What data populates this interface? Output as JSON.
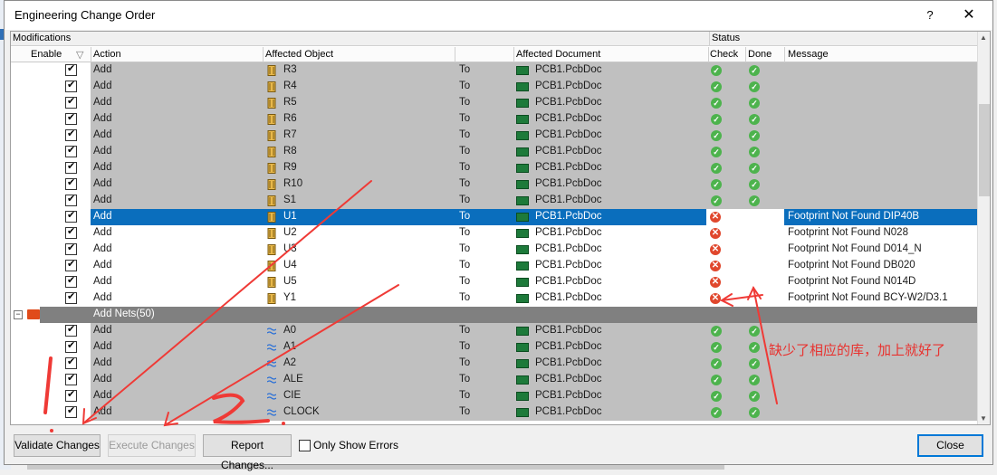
{
  "dialog": {
    "title": "Engineering Change Order",
    "help": "?",
    "close_glyph": "✕"
  },
  "grid": {
    "group_modifications": "Modifications",
    "group_status": "Status",
    "col_enable": "Enable",
    "col_action": "Action",
    "col_object": "Affected Object",
    "col_document": "Affected Document",
    "col_check": "Check",
    "col_done": "Done",
    "col_message": "Message",
    "rows": [
      {
        "kind": "ok",
        "action": "Add",
        "object": "R3",
        "to": "To",
        "doc": "PCB1.PcbDoc",
        "icon": "component-icon",
        "message": ""
      },
      {
        "kind": "ok",
        "action": "Add",
        "object": "R4",
        "to": "To",
        "doc": "PCB1.PcbDoc",
        "icon": "component-icon",
        "message": ""
      },
      {
        "kind": "ok",
        "action": "Add",
        "object": "R5",
        "to": "To",
        "doc": "PCB1.PcbDoc",
        "icon": "component-icon",
        "message": ""
      },
      {
        "kind": "ok",
        "action": "Add",
        "object": "R6",
        "to": "To",
        "doc": "PCB1.PcbDoc",
        "icon": "component-icon",
        "message": ""
      },
      {
        "kind": "ok",
        "action": "Add",
        "object": "R7",
        "to": "To",
        "doc": "PCB1.PcbDoc",
        "icon": "component-icon",
        "message": ""
      },
      {
        "kind": "ok",
        "action": "Add",
        "object": "R8",
        "to": "To",
        "doc": "PCB1.PcbDoc",
        "icon": "component-icon",
        "message": ""
      },
      {
        "kind": "ok",
        "action": "Add",
        "object": "R9",
        "to": "To",
        "doc": "PCB1.PcbDoc",
        "icon": "component-icon",
        "message": ""
      },
      {
        "kind": "ok",
        "action": "Add",
        "object": "R10",
        "to": "To",
        "doc": "PCB1.PcbDoc",
        "icon": "component-icon",
        "message": ""
      },
      {
        "kind": "ok",
        "action": "Add",
        "object": "S1",
        "to": "To",
        "doc": "PCB1.PcbDoc",
        "icon": "component-icon",
        "message": ""
      },
      {
        "kind": "sel",
        "action": "Add",
        "object": "U1",
        "to": "To",
        "doc": "PCB1.PcbDoc",
        "icon": "component-icon",
        "message": "Footprint Not Found DIP40B"
      },
      {
        "kind": "err",
        "action": "Add",
        "object": "U2",
        "to": "To",
        "doc": "PCB1.PcbDoc",
        "icon": "component-icon",
        "message": "Footprint Not Found N028"
      },
      {
        "kind": "err",
        "action": "Add",
        "object": "U3",
        "to": "To",
        "doc": "PCB1.PcbDoc",
        "icon": "component-icon",
        "message": "Footprint Not Found D014_N"
      },
      {
        "kind": "err",
        "action": "Add",
        "object": "U4",
        "to": "To",
        "doc": "PCB1.PcbDoc",
        "icon": "component-icon",
        "message": "Footprint Not Found DB020"
      },
      {
        "kind": "err",
        "action": "Add",
        "object": "U5",
        "to": "To",
        "doc": "PCB1.PcbDoc",
        "icon": "component-icon",
        "message": "Footprint Not Found N014D"
      },
      {
        "kind": "err",
        "action": "Add",
        "object": "Y1",
        "to": "To",
        "doc": "PCB1.PcbDoc",
        "icon": "component-icon",
        "message": "Footprint Not Found BCY-W2/D3.1"
      },
      {
        "kind": "grp",
        "label": "Add Nets(50)"
      },
      {
        "kind": "ok",
        "action": "Add",
        "object": "A0",
        "to": "To",
        "doc": "PCB1.PcbDoc",
        "icon": "net-icon",
        "message": ""
      },
      {
        "kind": "ok",
        "action": "Add",
        "object": "A1",
        "to": "To",
        "doc": "PCB1.PcbDoc",
        "icon": "net-icon",
        "message": ""
      },
      {
        "kind": "ok",
        "action": "Add",
        "object": "A2",
        "to": "To",
        "doc": "PCB1.PcbDoc",
        "icon": "net-icon",
        "message": ""
      },
      {
        "kind": "ok",
        "action": "Add",
        "object": "ALE",
        "to": "To",
        "doc": "PCB1.PcbDoc",
        "icon": "net-icon",
        "message": ""
      },
      {
        "kind": "ok",
        "action": "Add",
        "object": "CIE",
        "to": "To",
        "doc": "PCB1.PcbDoc",
        "icon": "net-icon",
        "message": ""
      },
      {
        "kind": "ok",
        "action": "Add",
        "object": "CLOCK",
        "to": "To",
        "doc": "PCB1.PcbDoc",
        "icon": "net-icon",
        "message": ""
      }
    ]
  },
  "buttons": {
    "validate": "Validate Changes",
    "execute": "Execute Changes",
    "report": "Report Changes...",
    "only_errors": "Only Show Errors",
    "close": "Close"
  },
  "annotation": {
    "note": "缺少了相应的库，加上就好了",
    "color": "#e8322f"
  }
}
